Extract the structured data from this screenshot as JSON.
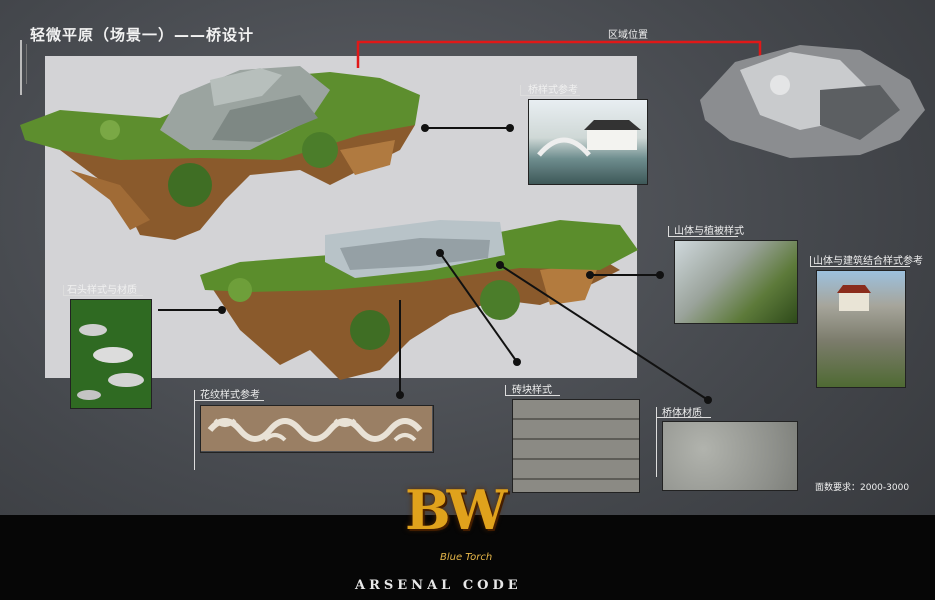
{
  "title": "轻微平原（场景一）——桥设计",
  "labels": {
    "region": "区域位置",
    "bridge_ref": "桥样式参考",
    "mountain_plant": "山体与植被样式",
    "mountain_building": "山体与建筑结合样式参考",
    "stone": "石头样式与材质",
    "pattern": "花纹样式参考",
    "brick": "砖块样式",
    "bridge_material": "桥体材质"
  },
  "face_count": "面数要求：2000-3000",
  "logo": {
    "main": "BW",
    "sub": "Blue Torch",
    "footer": "ARSENAL CODE"
  },
  "colors": {
    "accent_red": "#e01818",
    "panel": "#d3d3d6",
    "logo_gold": "#e0a21c"
  }
}
